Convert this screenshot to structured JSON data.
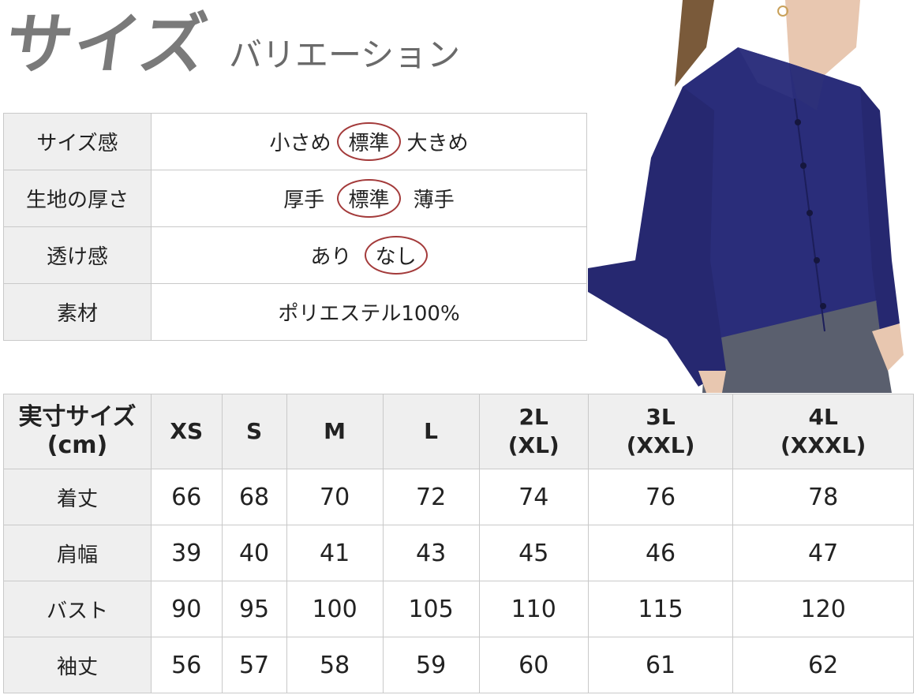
{
  "header": {
    "title": "サイズ",
    "subtitle": "バリエーション"
  },
  "attributes": [
    {
      "label": "サイズ感",
      "options": [
        {
          "text": "小さめ",
          "selected": false
        },
        {
          "text": "標準",
          "selected": true
        },
        {
          "text": "大きめ",
          "selected": false
        }
      ]
    },
    {
      "label": "生地の厚さ",
      "options": [
        {
          "text": "厚手",
          "selected": false
        },
        {
          "text": "標準",
          "selected": true
        },
        {
          "text": "薄手",
          "selected": false
        }
      ]
    },
    {
      "label": "透け感",
      "options": [
        {
          "text": "あり",
          "selected": false
        },
        {
          "text": "なし",
          "selected": true
        }
      ]
    },
    {
      "label": "素材",
      "value": "ポリエステル100%"
    }
  ],
  "size_table": {
    "corner": [
      "実寸サイズ",
      "(cm)"
    ],
    "sizes": [
      [
        "XS"
      ],
      [
        "S"
      ],
      [
        "M"
      ],
      [
        "L"
      ],
      [
        "2L",
        "(XL)"
      ],
      [
        "3L",
        "(XXL)"
      ],
      [
        "4L",
        "(XXXL)"
      ]
    ],
    "rows": [
      {
        "label": "着丈",
        "values": [
          "66",
          "68",
          "70",
          "72",
          "74",
          "76",
          "78"
        ]
      },
      {
        "label": "肩幅",
        "values": [
          "39",
          "40",
          "41",
          "43",
          "45",
          "46",
          "47"
        ]
      },
      {
        "label": "バスト",
        "values": [
          "90",
          "95",
          "100",
          "105",
          "110",
          "115",
          "120"
        ]
      },
      {
        "label": "袖丈",
        "values": [
          "56",
          "57",
          "58",
          "59",
          "60",
          "61",
          "62"
        ]
      }
    ]
  },
  "colors": {
    "shirt": "#2a2d7a",
    "skirt": "#5a5f6e",
    "highlight": "#a33a3a"
  },
  "image": {
    "alt": "navy-blouse-model-photo"
  }
}
